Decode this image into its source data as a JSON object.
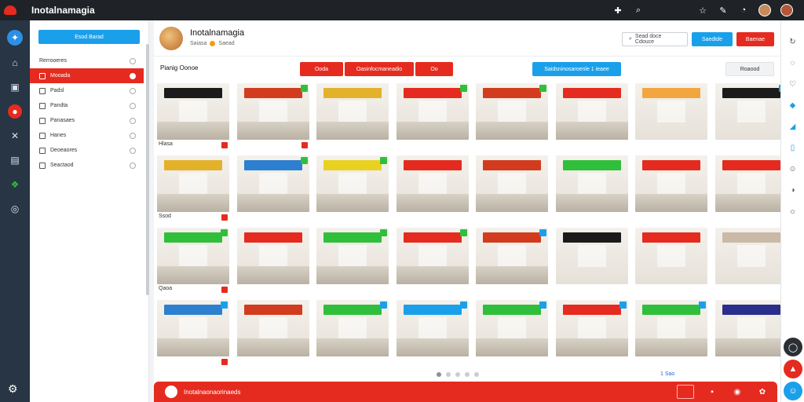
{
  "app": {
    "title": "Inotalnamagia"
  },
  "topbar": {
    "icons": [
      "puzzle-icon",
      "search-icon",
      "star-icon",
      "edit-icon",
      "bell-icon"
    ]
  },
  "rail": {
    "icons": [
      "compass-icon",
      "home-icon",
      "package-icon",
      "record-icon",
      "chart-icon",
      "monitor-icon",
      "leaf-icon",
      "gamepad-icon",
      "help-icon"
    ]
  },
  "nav": {
    "button_label": "Esod Barad",
    "items": [
      {
        "label": "Rerrooeres",
        "type": "header"
      },
      {
        "label": "Mooada",
        "type": "active"
      },
      {
        "label": "Padsl",
        "type": "item"
      },
      {
        "label": "Pandta",
        "type": "item"
      },
      {
        "label": "Panasaes",
        "type": "item"
      },
      {
        "label": "Hanes",
        "type": "item"
      },
      {
        "label": "Deoeaores",
        "type": "item"
      },
      {
        "label": "Seactaod",
        "type": "item"
      }
    ]
  },
  "page": {
    "title": "Inotalnamagia",
    "subtitle_left": "Saiasa",
    "subtitle_right": "Saead",
    "search_label": "Sead doce Cdouce",
    "blue_button": "Saedtde",
    "red_button": "Baenae"
  },
  "toolbar": {
    "filter_label": "Pianig Oonoe",
    "red1": "Ooda",
    "red2": "Oasinfocmaneadio",
    "red3": "Oo",
    "blue1": "Saidsninosaroenle 1 ieaee",
    "grey1": "Roaood"
  },
  "grid": {
    "rows": [
      [
        {
          "caption": "Hlasa",
          "sign": "#1b1b1b",
          "badge": "",
          "floor": true,
          "flag": true
        },
        {
          "caption": "",
          "sign": "#d23b1e",
          "badge": "#2fbf3b",
          "floor": true,
          "flag": true
        },
        {
          "caption": "",
          "sign": "#e3b12a",
          "badge": "",
          "floor": true,
          "flag": false
        },
        {
          "caption": "",
          "sign": "#e52b1f",
          "badge": "#2fbf3b",
          "floor": true,
          "flag": false
        },
        {
          "caption": "",
          "sign": "#d23b1e",
          "badge": "#2fbf3b",
          "floor": true,
          "flag": false
        },
        {
          "caption": "",
          "sign": "#e52b1f",
          "badge": "",
          "floor": true,
          "flag": false
        },
        {
          "caption": "",
          "sign": "#f2a640",
          "badge": "",
          "floor": false,
          "flag": false
        },
        {
          "caption": "",
          "sign": "#1b1b1b",
          "badge": "#1aa0ea",
          "floor": false,
          "flag": false
        }
      ],
      [
        {
          "caption": "Ssod",
          "sign": "#e3b12a",
          "badge": "",
          "floor": true,
          "flag": true
        },
        {
          "caption": "",
          "sign": "#2d7fd0",
          "badge": "#2fbf3b",
          "floor": true,
          "flag": false
        },
        {
          "caption": "",
          "sign": "#e8d21f",
          "badge": "#2fbf3b",
          "floor": true,
          "flag": false
        },
        {
          "caption": "",
          "sign": "#e52b1f",
          "badge": "",
          "floor": true,
          "flag": false
        },
        {
          "caption": "",
          "sign": "#d23b1e",
          "badge": "",
          "floor": true,
          "flag": false
        },
        {
          "caption": "",
          "sign": "#2fbf3b",
          "badge": "",
          "floor": true,
          "flag": false
        },
        {
          "caption": "",
          "sign": "#e52b1f",
          "badge": "",
          "floor": true,
          "flag": false
        },
        {
          "caption": "",
          "sign": "#e52b1f",
          "badge": "",
          "floor": true,
          "flag": false
        }
      ],
      [
        {
          "caption": "Qaoa",
          "sign": "#2fbf3b",
          "badge": "#2fbf3b",
          "floor": true,
          "flag": true
        },
        {
          "caption": "",
          "sign": "#e52b1f",
          "badge": "",
          "floor": true,
          "flag": false
        },
        {
          "caption": "",
          "sign": "#2fbf3b",
          "badge": "#2fbf3b",
          "floor": true,
          "flag": false
        },
        {
          "caption": "",
          "sign": "#e52b1f",
          "badge": "#2fbf3b",
          "floor": true,
          "flag": false
        },
        {
          "caption": "",
          "sign": "#d23b1e",
          "badge": "#1aa0ea",
          "floor": true,
          "flag": false
        },
        {
          "caption": "",
          "sign": "#1b1b1b",
          "badge": "",
          "floor": false,
          "flag": false
        },
        {
          "caption": "",
          "sign": "#e52b1f",
          "badge": "",
          "floor": false,
          "flag": false
        },
        {
          "caption": "",
          "sign": "#c9b9a6",
          "badge": "",
          "floor": false,
          "flag": false
        }
      ],
      [
        {
          "caption": "",
          "sign": "#2d7fd0",
          "badge": "#1aa0ea",
          "floor": true,
          "flag": true
        },
        {
          "caption": "",
          "sign": "#d23b1e",
          "badge": "",
          "floor": true,
          "flag": false
        },
        {
          "caption": "",
          "sign": "#2fbf3b",
          "badge": "#1aa0ea",
          "floor": true,
          "flag": false
        },
        {
          "caption": "",
          "sign": "#1aa0ea",
          "badge": "#1aa0ea",
          "floor": true,
          "flag": false
        },
        {
          "caption": "",
          "sign": "#2fbf3b",
          "badge": "#1aa0ea",
          "floor": true,
          "flag": false
        },
        {
          "caption": "",
          "sign": "#e52b1f",
          "badge": "#1aa0ea",
          "floor": true,
          "flag": false
        },
        {
          "caption": "",
          "sign": "#2fbf3b",
          "badge": "#1aa0ea",
          "floor": true,
          "flag": false
        },
        {
          "caption": "",
          "sign": "#2a2e8c",
          "badge": "",
          "floor": true,
          "flag": false
        }
      ]
    ]
  },
  "pager": {
    "page_text": "1 Sao"
  },
  "footer": {
    "text": "Inotalnaonaorinaeds",
    "buttons": [
      "square-icon",
      "save-icon",
      "location-icon",
      "settings-icon"
    ]
  },
  "right_rail": {
    "icons": [
      "rotate-icon",
      "globe-icon",
      "heart-icon",
      "tag-icon",
      "flag-icon",
      "doc-icon",
      "smile-icon",
      "chat-icon",
      "idea-icon"
    ]
  },
  "colors": {
    "accent_red": "#e52b1f",
    "accent_blue": "#1aa0ea",
    "dark": "#1f2328"
  }
}
